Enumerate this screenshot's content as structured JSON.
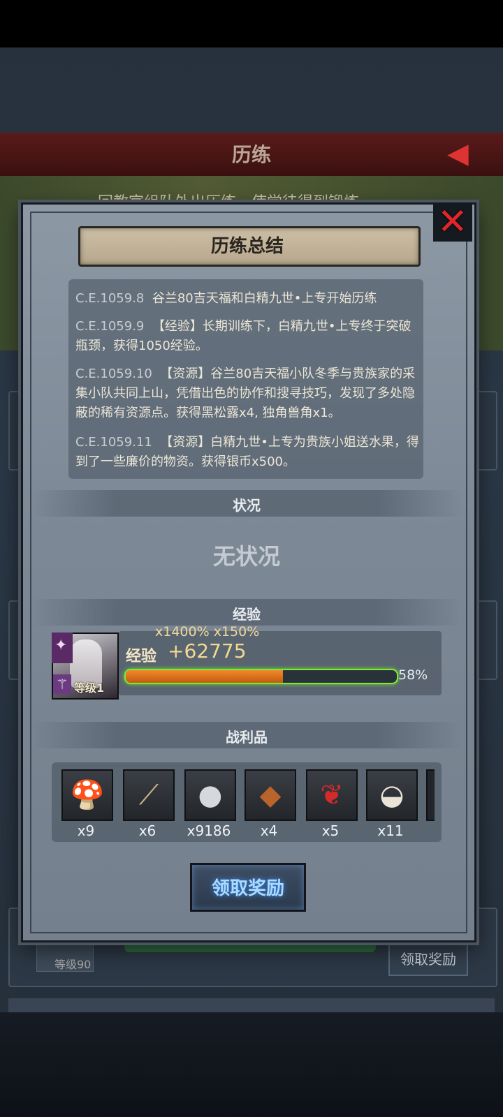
{
  "background": {
    "title": "历练",
    "subtitle": "回教官组队外出历练，使学徒得到锻炼",
    "hero_level": "等级90",
    "claim_label": "领取奖励"
  },
  "modal": {
    "title": "历练总结",
    "log": [
      {
        "date": "C.E.1059.8",
        "text": "谷兰80吉天福和白精九世•上专开始历练"
      },
      {
        "date": "C.E.1059.9",
        "text": "【经验】长期训练下，白精九世•上专终于突破瓶颈，获得1050经验。"
      },
      {
        "date": "C.E.1059.10",
        "text": "【资源】谷兰80吉天福小队冬季与贵族家的采集小队共同上山，凭借出色的协作和搜寻技巧，发现了多处隐蔽的稀有资源点。获得黑松露x4, 独角兽角x1。"
      },
      {
        "date": "C.E.1059.11",
        "text": "【资源】白精九世•上专为贵族小姐送水果，得到了一些廉价的物资。获得银币x500。"
      }
    ],
    "status_header": "状况",
    "status_value": "无状况",
    "exp_header": "经验",
    "exp": {
      "multipliers": "x1400% x150%",
      "label": "经验",
      "value": "+62775",
      "progress": 0.58,
      "percent_text": "58%",
      "hero_level": "等级1"
    },
    "loot_header": "战利品",
    "loot": [
      {
        "icon": "truffle-icon",
        "count": "x9"
      },
      {
        "icon": "unicorn-horn-icon",
        "count": "x6"
      },
      {
        "icon": "silver-coin-icon",
        "count": "x9186"
      },
      {
        "icon": "leather-icon",
        "count": "x4"
      },
      {
        "icon": "berries-icon",
        "count": "x5"
      },
      {
        "icon": "milk-bowl-icon",
        "count": "x11"
      }
    ],
    "claim_label": "领取奖励",
    "colors": {
      "accent": "#7ee83b",
      "exp_fill": "#f08a2a",
      "close": "#e0262b"
    }
  }
}
